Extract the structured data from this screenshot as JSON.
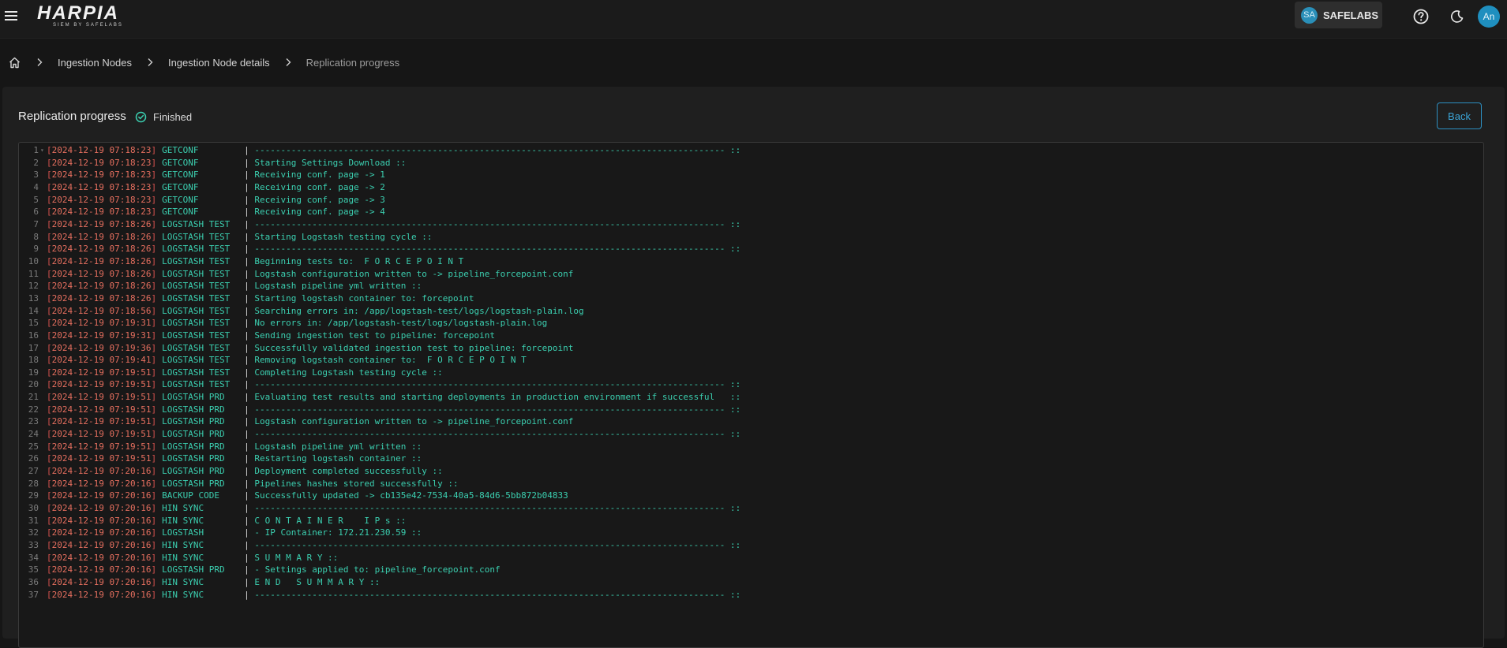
{
  "app": {
    "logo_main": "HARPIA",
    "logo_sub": "SIEM BY SAFELABS",
    "org_initials": "SA",
    "org_name": "SAFELABS",
    "user_initials": "An"
  },
  "breadcrumb": {
    "items": [
      "Ingestion Nodes",
      "Ingestion Node details"
    ],
    "current": "Replication progress"
  },
  "panel": {
    "title": "Replication progress",
    "status": "Finished",
    "back_label": "Back"
  },
  "icons": {
    "menu": "hamburger-icon",
    "home": "home-icon",
    "help": "help-circle-icon",
    "theme": "moon-icon",
    "status": "check-circle-icon"
  },
  "colors": {
    "accent": "#2d8fc1",
    "success": "#3bcfb0",
    "timestamp": "#e66f5f"
  },
  "log": [
    {
      "n": "1",
      "d": "2024-12-19",
      "t": "07:18:23",
      "tag": "GETCONF",
      "msg": "------------------------------------------------------------------------------------------ ::"
    },
    {
      "n": "2",
      "d": "2024-12-19",
      "t": "07:18:23",
      "tag": "GETCONF",
      "msg": "Starting Settings Download ::"
    },
    {
      "n": "3",
      "d": "2024-12-19",
      "t": "07:18:23",
      "tag": "GETCONF",
      "msg": "Receiving conf. page -> 1"
    },
    {
      "n": "4",
      "d": "2024-12-19",
      "t": "07:18:23",
      "tag": "GETCONF",
      "msg": "Receiving conf. page -> 2"
    },
    {
      "n": "5",
      "d": "2024-12-19",
      "t": "07:18:23",
      "tag": "GETCONF",
      "msg": "Receiving conf. page -> 3"
    },
    {
      "n": "6",
      "d": "2024-12-19",
      "t": "07:18:23",
      "tag": "GETCONF",
      "msg": "Receiving conf. page -> 4"
    },
    {
      "n": "7",
      "d": "2024-12-19",
      "t": "07:18:26",
      "tag": "LOGSTASH TEST",
      "msg": "------------------------------------------------------------------------------------------ ::"
    },
    {
      "n": "8",
      "d": "2024-12-19",
      "t": "07:18:26",
      "tag": "LOGSTASH TEST",
      "msg": "Starting Logstash testing cycle ::"
    },
    {
      "n": "9",
      "d": "2024-12-19",
      "t": "07:18:26",
      "tag": "LOGSTASH TEST",
      "msg": "------------------------------------------------------------------------------------------ ::"
    },
    {
      "n": "10",
      "d": "2024-12-19",
      "t": "07:18:26",
      "tag": "LOGSTASH TEST",
      "msg": "Beginning tests to:  F O R C E P O I N T"
    },
    {
      "n": "11",
      "d": "2024-12-19",
      "t": "07:18:26",
      "tag": "LOGSTASH TEST",
      "msg": "Logstash configuration written to -> pipeline_forcepoint.conf"
    },
    {
      "n": "12",
      "d": "2024-12-19",
      "t": "07:18:26",
      "tag": "LOGSTASH TEST",
      "msg": "Logstash pipeline yml written ::"
    },
    {
      "n": "13",
      "d": "2024-12-19",
      "t": "07:18:26",
      "tag": "LOGSTASH TEST",
      "msg": "Starting logstash container to: forcepoint"
    },
    {
      "n": "14",
      "d": "2024-12-19",
      "t": "07:18:56",
      "tag": "LOGSTASH TEST",
      "msg": "Searching errors in: /app/logstash-test/logs/logstash-plain.log"
    },
    {
      "n": "15",
      "d": "2024-12-19",
      "t": "07:19:31",
      "tag": "LOGSTASH TEST",
      "msg": "No errors in: /app/logstash-test/logs/logstash-plain.log"
    },
    {
      "n": "16",
      "d": "2024-12-19",
      "t": "07:19:31",
      "tag": "LOGSTASH TEST",
      "msg": "Sending ingestion test to pipeline: forcepoint"
    },
    {
      "n": "17",
      "d": "2024-12-19",
      "t": "07:19:36",
      "tag": "LOGSTASH TEST",
      "msg": "Successfully validated ingestion test to pipeline: forcepoint"
    },
    {
      "n": "18",
      "d": "2024-12-19",
      "t": "07:19:41",
      "tag": "LOGSTASH TEST",
      "msg": "Removing logstash container to:  F O R C E P O I N T"
    },
    {
      "n": "19",
      "d": "2024-12-19",
      "t": "07:19:51",
      "tag": "LOGSTASH TEST",
      "msg": "Completing Logstash testing cycle ::"
    },
    {
      "n": "20",
      "d": "2024-12-19",
      "t": "07:19:51",
      "tag": "LOGSTASH TEST",
      "msg": "------------------------------------------------------------------------------------------ ::"
    },
    {
      "n": "21",
      "d": "2024-12-19",
      "t": "07:19:51",
      "tag": "LOGSTASH PRD",
      "msg": "Evaluating test results and starting deployments in production environment if successful   ::"
    },
    {
      "n": "22",
      "d": "2024-12-19",
      "t": "07:19:51",
      "tag": "LOGSTASH PRD",
      "msg": "------------------------------------------------------------------------------------------ ::"
    },
    {
      "n": "23",
      "d": "2024-12-19",
      "t": "07:19:51",
      "tag": "LOGSTASH PRD",
      "msg": "Logstash configuration written to -> pipeline_forcepoint.conf"
    },
    {
      "n": "24",
      "d": "2024-12-19",
      "t": "07:19:51",
      "tag": "LOGSTASH PRD",
      "msg": "------------------------------------------------------------------------------------------ ::"
    },
    {
      "n": "25",
      "d": "2024-12-19",
      "t": "07:19:51",
      "tag": "LOGSTASH PRD",
      "msg": "Logstash pipeline yml written ::"
    },
    {
      "n": "26",
      "d": "2024-12-19",
      "t": "07:19:51",
      "tag": "LOGSTASH PRD",
      "msg": "Restarting logstash container ::"
    },
    {
      "n": "27",
      "d": "2024-12-19",
      "t": "07:20:16",
      "tag": "LOGSTASH PRD",
      "msg": "Deployment completed successfully ::"
    },
    {
      "n": "28",
      "d": "2024-12-19",
      "t": "07:20:16",
      "tag": "LOGSTASH PRD",
      "msg": "Pipelines hashes stored successfully ::"
    },
    {
      "n": "29",
      "d": "2024-12-19",
      "t": "07:20:16",
      "tag": "BACKUP CODE",
      "msg": "Successfully updated -> cb135e42-7534-40a5-84d6-5bb872b04833"
    },
    {
      "n": "30",
      "d": "2024-12-19",
      "t": "07:20:16",
      "tag": "HIN SYNC",
      "msg": "------------------------------------------------------------------------------------------ ::"
    },
    {
      "n": "31",
      "d": "2024-12-19",
      "t": "07:20:16",
      "tag": "HIN SYNC",
      "msg": "C O N T A I N E R    I P s ::"
    },
    {
      "n": "32",
      "d": "2024-12-19",
      "t": "07:20:16",
      "tag": "LOGSTASH",
      "msg": "- IP Container: 172.21.230.59 ::"
    },
    {
      "n": "33",
      "d": "2024-12-19",
      "t": "07:20:16",
      "tag": "HIN SYNC",
      "msg": "------------------------------------------------------------------------------------------ ::"
    },
    {
      "n": "34",
      "d": "2024-12-19",
      "t": "07:20:16",
      "tag": "HIN SYNC",
      "msg": "S U M M A R Y ::"
    },
    {
      "n": "35",
      "d": "2024-12-19",
      "t": "07:20:16",
      "tag": "LOGSTASH PRD",
      "msg": "- Settings applied to: pipeline_forcepoint.conf"
    },
    {
      "n": "36",
      "d": "2024-12-19",
      "t": "07:20:16",
      "tag": "HIN SYNC",
      "msg": "E N D   S U M M A R Y ::"
    },
    {
      "n": "37",
      "d": "2024-12-19",
      "t": "07:20:16",
      "tag": "HIN SYNC",
      "msg": "------------------------------------------------------------------------------------------ ::"
    }
  ]
}
